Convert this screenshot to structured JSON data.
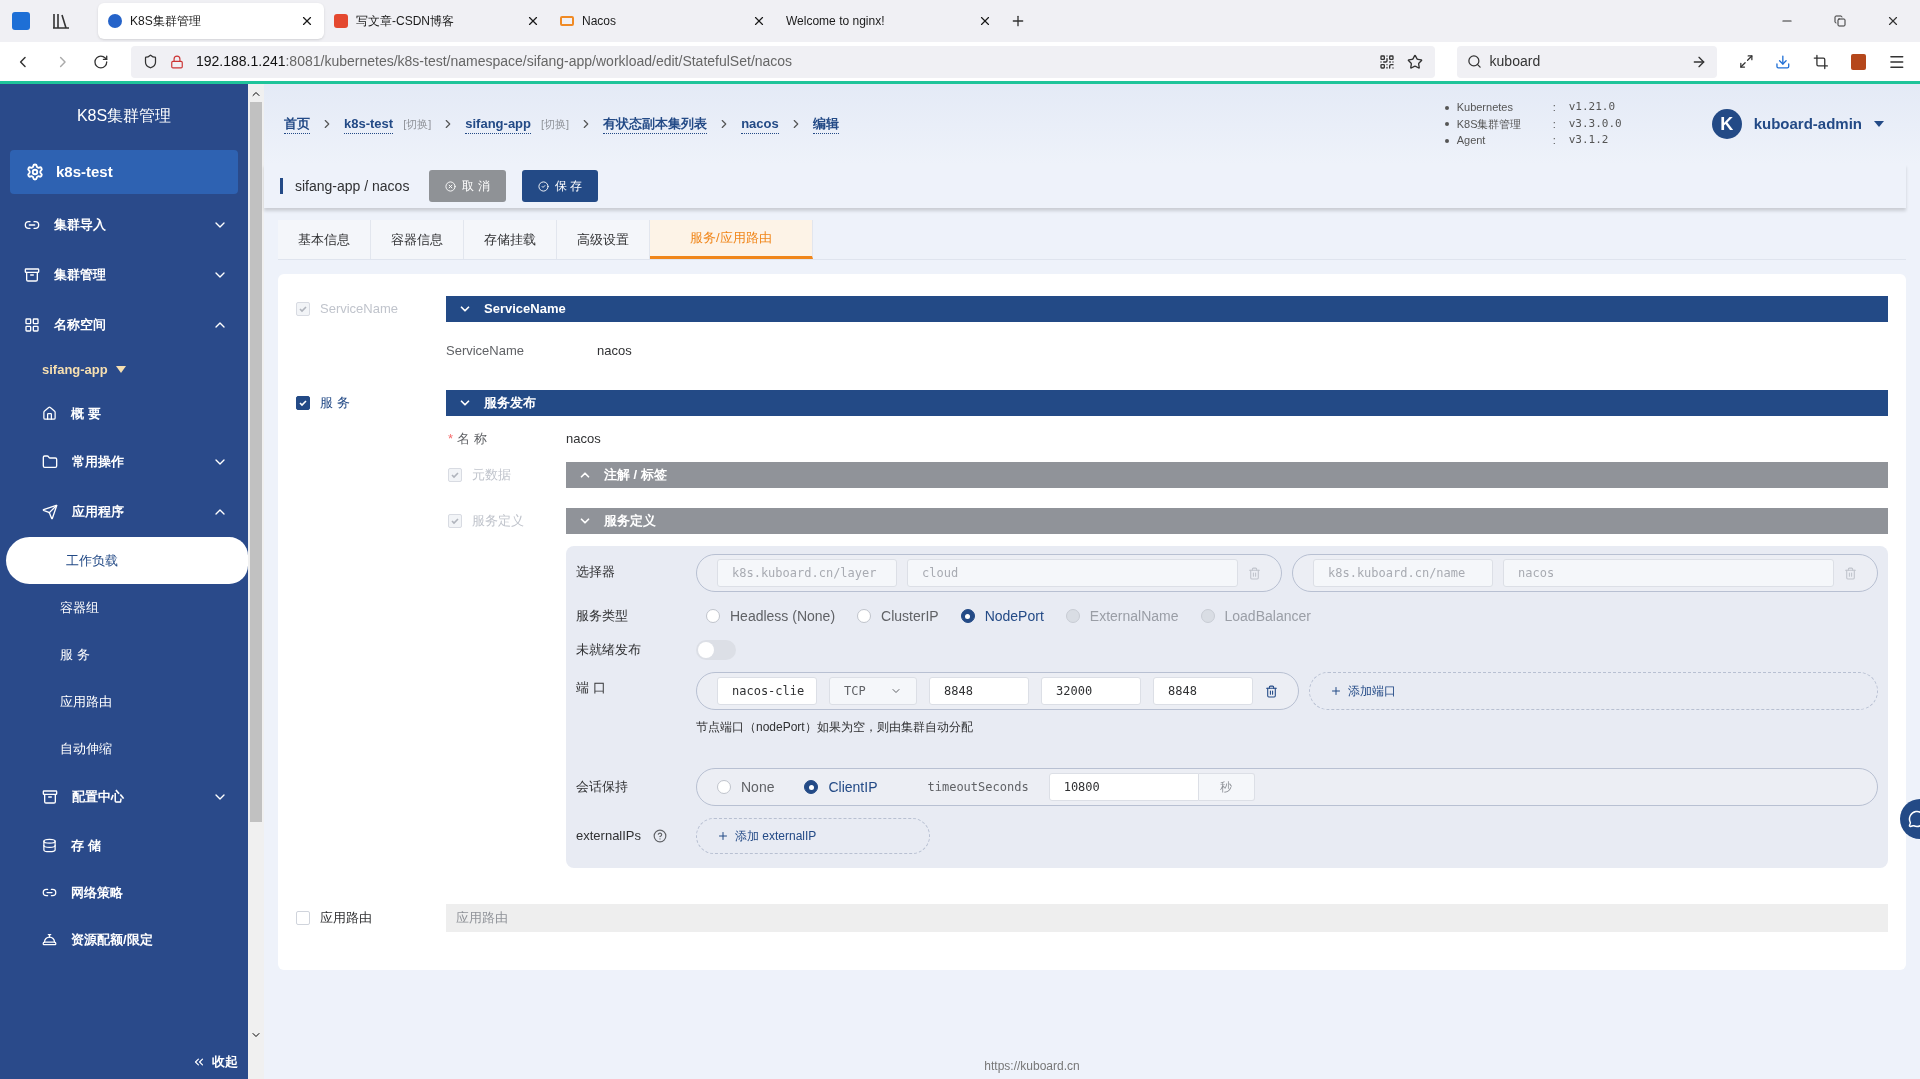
{
  "browser": {
    "tabs": [
      {
        "title": "K8S集群管理",
        "selected": true
      },
      {
        "title": "写文章-CSDN博客",
        "selected": false
      },
      {
        "title": "Nacos",
        "selected": false
      },
      {
        "title": "Welcome to nginx!",
        "selected": false
      }
    ],
    "url_host": "192.188.1.241",
    "url_path": ":8081/kubernetes/k8s-test/namespace/sifang-app/workload/edit/StatefulSet/nacos",
    "search": "kuboard"
  },
  "sidebar": {
    "title": "K8S集群管理",
    "cluster": "k8s-test",
    "collapse": "收起",
    "items": [
      {
        "kind": "group",
        "label": "集群导入",
        "expanded": false,
        "selected": false
      },
      {
        "kind": "group",
        "label": "集群管理",
        "expanded": false,
        "selected": false
      },
      {
        "kind": "group",
        "label": "名称空间",
        "expanded": true,
        "selected": false,
        "children": [
          {
            "kind": "namespace",
            "label": "sifang-app",
            "selected": false
          },
          {
            "kind": "link",
            "label": "概 要",
            "selected": false
          },
          {
            "kind": "group",
            "label": "常用操作",
            "expanded": false,
            "selected": false
          },
          {
            "kind": "group",
            "label": "应用程序",
            "expanded": true,
            "selected": false,
            "children": [
              {
                "kind": "link",
                "label": "工作负载",
                "selected": true
              },
              {
                "kind": "link",
                "label": "容器组",
                "selected": false
              },
              {
                "kind": "link",
                "label": "服 务",
                "selected": false
              },
              {
                "kind": "link",
                "label": "应用路由",
                "selected": false
              },
              {
                "kind": "link",
                "label": "自动伸缩",
                "selected": false
              }
            ]
          },
          {
            "kind": "group",
            "label": "配置中心",
            "expanded": false,
            "selected": false
          },
          {
            "kind": "link",
            "label": "存 储",
            "selected": false
          },
          {
            "kind": "link",
            "label": "网络策略",
            "selected": false
          },
          {
            "kind": "link",
            "label": "资源配额/限定",
            "selected": false
          }
        ]
      }
    ]
  },
  "breadcrumb": [
    {
      "label": "首页"
    },
    {
      "label": "k8s-test",
      "switch": "[切换]"
    },
    {
      "label": "sifang-app",
      "switch": "[切换]"
    },
    {
      "label": "有状态副本集列表"
    },
    {
      "label": "nacos"
    },
    {
      "label": "编辑"
    }
  ],
  "versions": [
    {
      "name": "Kubernetes",
      "separator": ":",
      "value": "v1.21.0"
    },
    {
      "name": "K8S集群管理",
      "separator": ":",
      "value": "v3.3.0.0"
    },
    {
      "name": "Agent",
      "separator": ":",
      "value": "v3.1.2"
    }
  ],
  "user": {
    "initial": "K",
    "name": "kuboard-admin"
  },
  "toolbar": {
    "title": "sifang-app / nacos",
    "buttons": [
      {
        "label": "取 消",
        "kind": "cancel"
      },
      {
        "label": "保 存",
        "kind": "save"
      }
    ]
  },
  "tabs": [
    {
      "label": "基本信息",
      "selected": false
    },
    {
      "label": "容器信息",
      "selected": false
    },
    {
      "label": "存储挂载",
      "selected": false
    },
    {
      "label": "高级设置",
      "selected": false
    },
    {
      "label": "服务/应用路由",
      "selected": true
    }
  ],
  "form": {
    "service_name": {
      "label": "ServiceName",
      "checked": true,
      "disabled": true,
      "header": "ServiceName",
      "expanded": true,
      "field_label": "ServiceName",
      "value": "nacos"
    },
    "service": {
      "label": "服 务",
      "checked": true,
      "disabled": false,
      "header": "服务发布",
      "expanded": true,
      "name_required_mark": "*",
      "name_label": "名 称",
      "name_value": "nacos",
      "metadata": {
        "label": "元数据",
        "checked": true,
        "disabled": true,
        "header": "注解 / 标签",
        "expanded": false
      },
      "definition": {
        "label": "服务定义",
        "checked": true,
        "disabled": true,
        "header": "服务定义",
        "expanded": true
      },
      "selector": {
        "label": "选择器",
        "pairs": [
          {
            "key": "k8s.kuboard.cn/layer",
            "value": "cloud"
          },
          {
            "key": "k8s.kuboard.cn/name",
            "value": "nacos"
          }
        ]
      },
      "service_type": {
        "label": "服务类型",
        "options": [
          {
            "label": "Headless (None)",
            "selected": false,
            "disabled": false
          },
          {
            "label": "ClusterIP",
            "selected": false,
            "disabled": false
          },
          {
            "label": "NodePort",
            "selected": true,
            "disabled": false
          },
          {
            "label": "ExternalName",
            "selected": false,
            "disabled": true
          },
          {
            "label": "LoadBalancer",
            "selected": false,
            "disabled": true
          }
        ]
      },
      "unready": {
        "label": "未就绪发布",
        "on": false
      },
      "ports": {
        "label": "端 口",
        "rows": [
          {
            "name": "nacos-clie",
            "protocol": "TCP",
            "port": "8848",
            "node_port": "32000",
            "target_port": "8848"
          }
        ],
        "add": "添加端口",
        "hint": "节点端口（nodePort）如果为空，则由集群自动分配"
      },
      "session": {
        "label": "会话保持",
        "options": [
          {
            "label": "None",
            "selected": false
          },
          {
            "label": "ClientIP",
            "selected": true
          }
        ],
        "timeout_label": "timeoutSeconds",
        "timeout": "10800",
        "unit": "秒"
      },
      "external_ips": {
        "label": "externalIPs",
        "add": "添加 externalIP"
      }
    },
    "ingress": {
      "label": "应用路由",
      "checked": false,
      "disabled": false,
      "header": "应用路由"
    }
  },
  "footer": "https://kuboard.cn"
}
